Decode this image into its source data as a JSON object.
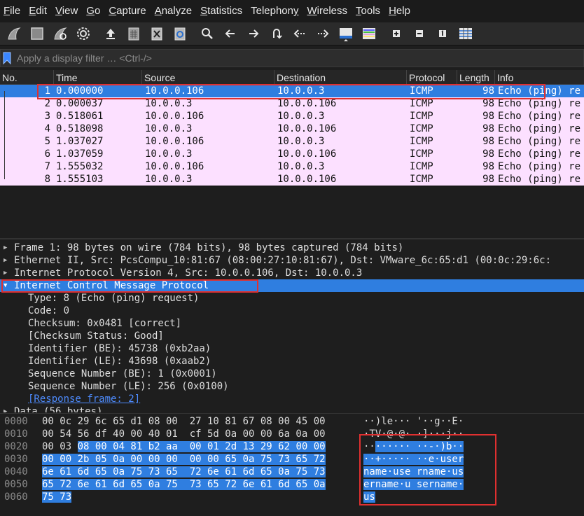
{
  "menu": [
    "File",
    "Edit",
    "View",
    "Go",
    "Capture",
    "Analyze",
    "Statistics",
    "Telephony",
    "Wireless",
    "Tools",
    "Help"
  ],
  "menu_underline": [
    "F",
    "E",
    "V",
    "G",
    "C",
    "A",
    "S",
    "y",
    "W",
    "T",
    "H"
  ],
  "filter": {
    "placeholder": "Apply a display filter … <Ctrl-/>"
  },
  "columns": {
    "no": "No.",
    "time": "Time",
    "source": "Source",
    "destination": "Destination",
    "protocol": "Protocol",
    "length": "Length",
    "info": "Info"
  },
  "packets": [
    {
      "no": "1",
      "time": "0.000000",
      "src": "10.0.0.106",
      "dst": "10.0.0.3",
      "proto": "ICMP",
      "len": "98",
      "info": "Echo (ping) re"
    },
    {
      "no": "2",
      "time": "0.000037",
      "src": "10.0.0.3",
      "dst": "10.0.0.106",
      "proto": "ICMP",
      "len": "98",
      "info": "Echo (ping) re"
    },
    {
      "no": "3",
      "time": "0.518061",
      "src": "10.0.0.106",
      "dst": "10.0.0.3",
      "proto": "ICMP",
      "len": "98",
      "info": "Echo (ping) re"
    },
    {
      "no": "4",
      "time": "0.518098",
      "src": "10.0.0.3",
      "dst": "10.0.0.106",
      "proto": "ICMP",
      "len": "98",
      "info": "Echo (ping) re"
    },
    {
      "no": "5",
      "time": "1.037027",
      "src": "10.0.0.106",
      "dst": "10.0.0.3",
      "proto": "ICMP",
      "len": "98",
      "info": "Echo (ping) re"
    },
    {
      "no": "6",
      "time": "1.037059",
      "src": "10.0.0.3",
      "dst": "10.0.0.106",
      "proto": "ICMP",
      "len": "98",
      "info": "Echo (ping) re"
    },
    {
      "no": "7",
      "time": "1.555032",
      "src": "10.0.0.106",
      "dst": "10.0.0.3",
      "proto": "ICMP",
      "len": "98",
      "info": "Echo (ping) re"
    },
    {
      "no": "8",
      "time": "1.555103",
      "src": "10.0.0.3",
      "dst": "10.0.0.106",
      "proto": "ICMP",
      "len": "98",
      "info": "Echo (ping) re"
    }
  ],
  "details": [
    {
      "text": "Frame 1: 98 bytes on wire (784 bits), 98 bytes captured (784 bits)",
      "expander": "collapsed"
    },
    {
      "text": "Ethernet II, Src: PcsCompu_10:81:67 (08:00:27:10:81:67), Dst: VMware_6c:65:d1 (00:0c:29:6c:",
      "expander": "collapsed"
    },
    {
      "text": "Internet Protocol Version 4, Src: 10.0.0.106, Dst: 10.0.0.3",
      "expander": "collapsed"
    },
    {
      "text": "Internet Control Message Protocol",
      "expander": "expanded"
    },
    {
      "text": "Type: 8 (Echo (ping) request)"
    },
    {
      "text": "Code: 0"
    },
    {
      "text": "Checksum: 0x0481 [correct]"
    },
    {
      "text": "[Checksum Status: Good]"
    },
    {
      "text": "Identifier (BE): 45738 (0xb2aa)"
    },
    {
      "text": "Identifier (LE): 43698 (0xaab2)"
    },
    {
      "text": "Sequence Number (BE): 1 (0x0001)"
    },
    {
      "text": "Sequence Number (LE): 256 (0x0100)"
    },
    {
      "text": "[Response frame: 2]",
      "link": true
    },
    {
      "text": "Data (56 bytes)",
      "expander": "collapsed"
    }
  ],
  "bytes": [
    {
      "offset": "0000",
      "hex_plain": "00 0c 29 6c 65 d1 08 00  27 10 81 67 08 00 45 00",
      "hex_hl": "",
      "ascii_plain": "··)le··· '··g··E·",
      "ascii_hl": ""
    },
    {
      "offset": "0010",
      "hex_plain": "00 54 56 df 40 00 40 01  cf 5d 0a 00 00 6a 0a 00",
      "hex_hl": "",
      "ascii_plain": "·TV·@·@· ·]···j··",
      "ascii_hl": ""
    },
    {
      "offset": "0020",
      "hex_plain": "00 03 ",
      "hex_hl": "08 00 04 81 b2 aa  00 01 2d 13 29 62 00 00",
      "ascii_plain": "··",
      "ascii_hl": "······ ··-·)b··"
    },
    {
      "offset": "0030",
      "hex_plain": "",
      "hex_hl": "00 00 2b 05 0a 00 00 00  00 00 65 0a 75 73 65 72",
      "ascii_plain": "",
      "ascii_hl": "··+····· ··e·user"
    },
    {
      "offset": "0040",
      "hex_plain": "",
      "hex_hl": "6e 61 6d 65 0a 75 73 65  72 6e 61 6d 65 0a 75 73",
      "ascii_plain": "",
      "ascii_hl": "name·use rname·us"
    },
    {
      "offset": "0050",
      "hex_plain": "",
      "hex_hl": "65 72 6e 61 6d 65 0a 75  73 65 72 6e 61 6d 65 0a",
      "ascii_plain": "",
      "ascii_hl": "ername·u sername·"
    },
    {
      "offset": "0060",
      "hex_plain": "",
      "hex_hl": "75 73",
      "ascii_plain": "",
      "ascii_hl": "us"
    }
  ],
  "colors": {
    "selection": "#2f7ee0",
    "icmp_row": "#fce0ff",
    "annotation": "#e03030",
    "link": "#4e8cff"
  },
  "toolbar_icons": [
    "shark-fin-start-icon",
    "stop-square-icon",
    "restart-fin-icon",
    "options-gear-icon",
    "open-file-icon",
    "save-file-icon",
    "close-file-icon",
    "reload-file-icon",
    "search-icon",
    "back-arrow-icon",
    "forward-arrow-icon",
    "go-to-packet-icon",
    "first-packet-icon",
    "last-packet-icon",
    "autoscroll-icon",
    "colorize-icon",
    "zoom-in-icon",
    "zoom-out-icon",
    "normal-size-icon",
    "resize-columns-icon"
  ]
}
